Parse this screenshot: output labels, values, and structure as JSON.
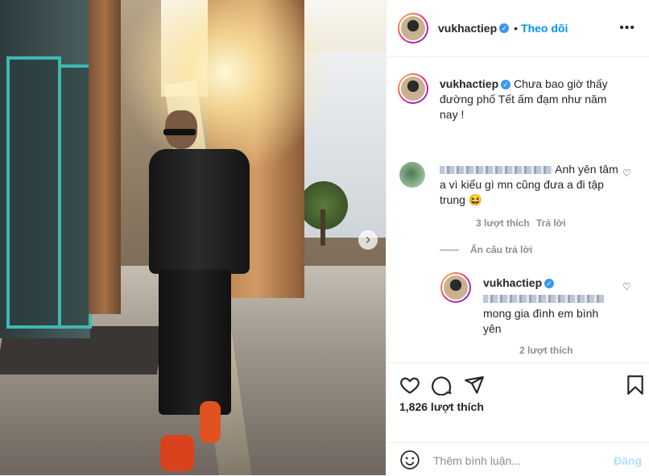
{
  "post": {
    "image_alt": "Man in black outfit walking on sunlit street",
    "next_icon": "chevron-right-icon"
  },
  "header": {
    "username": "vukhactiep",
    "verified": true,
    "dot": "•",
    "follow_label": "Theo dõi",
    "more_label": "•••"
  },
  "caption": {
    "username": "vukhactiep",
    "text": "Chưa bao giờ thấy đường phố Tết ấm đạm như năm nay !"
  },
  "comments": [
    {
      "username_blurred": true,
      "text": "Anh yên tâm a vì kiểu gì mn cũng đưa a đi tập trung 😆",
      "likes": "3 lượt thích",
      "reply_label": "Trả lời",
      "hide_replies_label": "Ẩn câu trả lời",
      "replies": [
        {
          "username": "vukhactiep",
          "text": "mong gia đình em bình yên",
          "likes": "2 lượt thích"
        }
      ]
    }
  ],
  "actions": {
    "like_icon": "heart-icon",
    "comment_icon": "comment-icon",
    "share_icon": "share-icon",
    "save_icon": "bookmark-icon",
    "likes_count": "1,826 lượt thích"
  },
  "add_comment": {
    "placeholder": "Thêm bình luận...",
    "post_label": "Đăng",
    "emoji_icon": "emoji-icon"
  },
  "colors": {
    "accent": "#0095f6",
    "verified": "#3897f0",
    "muted": "#8e8e8e"
  }
}
